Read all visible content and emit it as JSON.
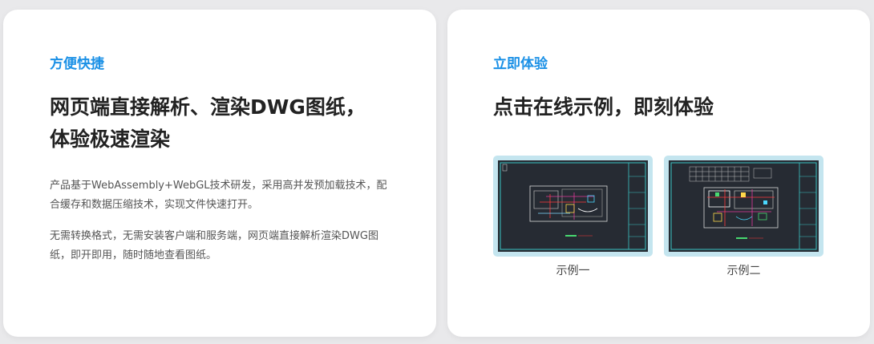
{
  "left_card": {
    "eyebrow": "方便快捷",
    "headline_line1": "网页端直接解析、渲染DWG图纸，",
    "headline_line2": "体验极速渲染",
    "paragraph1": "产品基于WebAssembly+WebGL技术研发，采用高并发预加载技术，配合缓存和数据压缩技术，实现文件快速打开。",
    "paragraph2": "无需转换格式，无需安装客户端和服务端，网页端直接解析渲染DWG图纸，即开即用，随时随地查看图纸。"
  },
  "right_card": {
    "eyebrow": "立即体验",
    "headline": "点击在线示例，即刻体验",
    "examples": [
      {
        "caption": "示例一",
        "thumbnail_icon": "dwg-drawing-thumbnail"
      },
      {
        "caption": "示例二",
        "thumbnail_icon": "dwg-drawing-thumbnail"
      }
    ]
  },
  "colors": {
    "accent": "#1a90e6",
    "headline": "#222222",
    "body_text": "#555555",
    "thumbnail_frame": "#c4e5ef",
    "drawing_background": "#262b33"
  }
}
